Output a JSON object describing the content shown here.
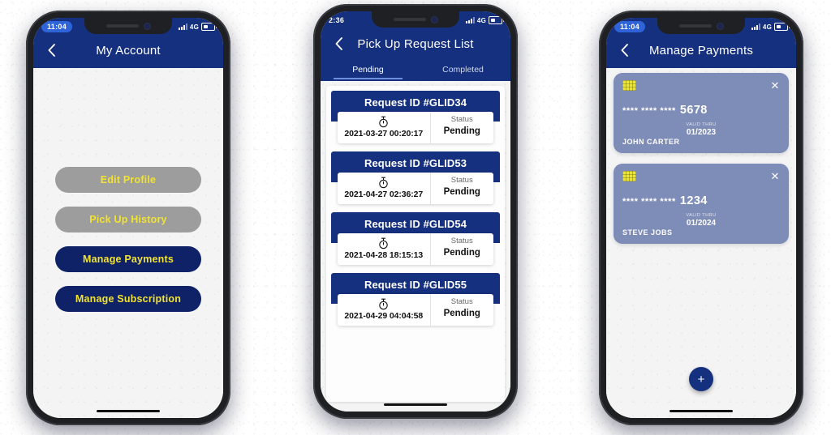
{
  "theme": {
    "navy": "#15307e",
    "deep_navy": "#0f2167",
    "yellow": "#f2e32f",
    "grey_button": "#9d9d9d",
    "card_purple": "#7e8cb8",
    "chip_yellow": "#e9e43f"
  },
  "phones": [
    {
      "id": "my-account",
      "status": {
        "time": "11:04",
        "network": "4G",
        "time_style": "pill"
      },
      "appbar": {
        "back_icon": "chevron-left-icon",
        "title": "My Account"
      },
      "buttons": [
        {
          "label": "Edit Profile",
          "style": "grey"
        },
        {
          "label": "Pick Up History",
          "style": "grey"
        },
        {
          "label": "Manage Payments",
          "style": "navy"
        },
        {
          "label": "Manage Subscription",
          "style": "navy"
        }
      ]
    },
    {
      "id": "pick-up-request-list",
      "status": {
        "time": "2:36",
        "network": "4G",
        "time_style": "plain"
      },
      "appbar": {
        "back_icon": "chevron-left-icon",
        "title": "Pick Up Request List"
      },
      "tabs": [
        {
          "label": "Pending",
          "active": true
        },
        {
          "label": "Completed",
          "active": false
        }
      ],
      "status_column_label": "Status",
      "clock_icon": "stopwatch-icon",
      "requests": [
        {
          "title": "Request ID #GLID34",
          "time": "2021-03-27 00:20:17",
          "status": "Pending"
        },
        {
          "title": "Request ID #GLID53",
          "time": "2021-04-27 02:36:27",
          "status": "Pending"
        },
        {
          "title": "Request ID #GLID54",
          "time": "2021-04-28 18:15:13",
          "status": "Pending"
        },
        {
          "title": "Request ID #GLID55",
          "time": "2021-04-29 04:04:58",
          "status": "Pending"
        }
      ]
    },
    {
      "id": "manage-payments",
      "status": {
        "time": "11:04",
        "network": "4G",
        "time_style": "pill"
      },
      "appbar": {
        "back_icon": "chevron-left-icon",
        "title": "Manage Payments"
      },
      "valid_thru_label": "VALID THRU",
      "remove_icon": "close-icon",
      "chip_icon": "card-chip-icon",
      "add_label": "+",
      "cards": [
        {
          "masked": "**** **** ****",
          "last4": "5678",
          "valid_thru": "01/2023",
          "holder": "JOHN CARTER"
        },
        {
          "masked": "**** **** ****",
          "last4": "1234",
          "valid_thru": "01/2024",
          "holder": "STEVE JOBS"
        }
      ]
    }
  ]
}
